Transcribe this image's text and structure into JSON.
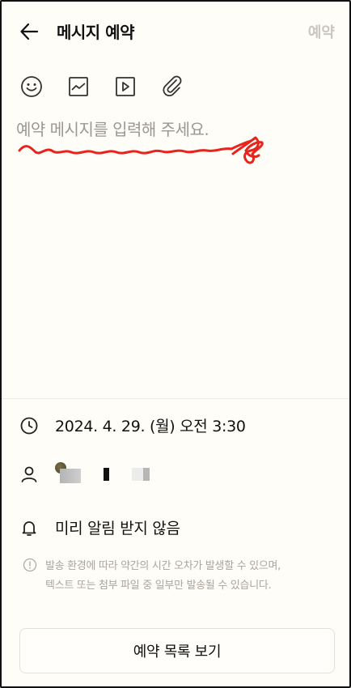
{
  "header": {
    "title": "메시지 예약",
    "reserve_label": "예약"
  },
  "composer": {
    "placeholder": "예약 메시지를 입력해 주세요."
  },
  "toolbar": {
    "icons": [
      "emoji-icon",
      "image-icon",
      "video-icon",
      "attachment-icon"
    ]
  },
  "schedule": {
    "datetime": "2024. 4. 29. (월) 오전 3:30"
  },
  "alarm": {
    "label": "미리 알림 받지 않음"
  },
  "notice": {
    "line1": "발송 환경에 따라 약간의 시간 오차가 발생할 수 있으며,",
    "line2": "텍스트 또는 첨부 파일 중 일부만 발송될 수 있습니다."
  },
  "footer": {
    "list_button_label": "예약 목록 보기"
  },
  "colors": {
    "background": "#fffdf7",
    "scribble": "#e8231b",
    "disabled_text": "#c9c6c0",
    "hint_text": "#aaa59c"
  }
}
